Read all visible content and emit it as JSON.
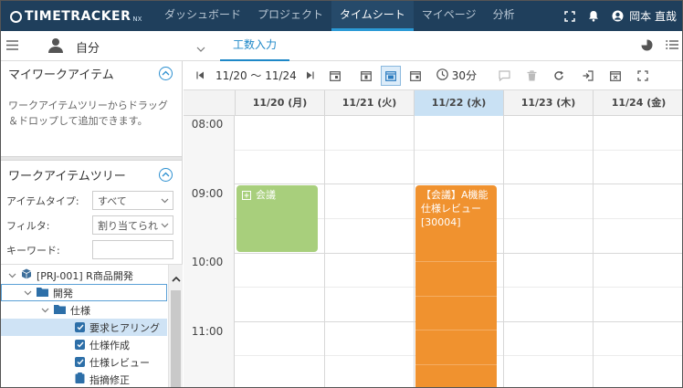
{
  "app": {
    "logo_text": "TIMETRACKER",
    "logo_sub": "NX"
  },
  "nav": {
    "items": [
      {
        "label": "ダッシュボード",
        "active": false
      },
      {
        "label": "プロジェクト",
        "active": false
      },
      {
        "label": "タイムシート",
        "active": true
      },
      {
        "label": "マイページ",
        "active": false
      },
      {
        "label": "分析",
        "active": false
      }
    ],
    "user_name": "岡本 直哉"
  },
  "secondbar": {
    "user_label": "自分",
    "tab_label": "工数入力"
  },
  "left": {
    "mywork": {
      "title": "マイワークアイテム",
      "description": "ワークアイテムツリーからドラッグ＆ドロップして追加できます。"
    },
    "tree_panel": {
      "title": "ワークアイテムツリー",
      "filters": [
        {
          "label": "アイテムタイプ:",
          "value": "すべて"
        },
        {
          "label": "フィルタ:",
          "value": "割り当てられ"
        },
        {
          "label": "キーワード:",
          "value": ""
        }
      ],
      "nodes": [
        {
          "label": "[PRJ-001] R商品開発",
          "level": 0
        },
        {
          "label": "開発",
          "level": 1
        },
        {
          "label": "仕様",
          "level": 2
        },
        {
          "label": "要求ヒアリング",
          "level": 3
        },
        {
          "label": "仕様作成",
          "level": 3
        },
        {
          "label": "仕様レビュー",
          "level": 3
        },
        {
          "label": "指摘修正",
          "level": 3
        }
      ]
    }
  },
  "calendar": {
    "date_range": "11/20 ～ 11/24",
    "interval_label": "30分",
    "days": [
      {
        "label": "11/20 (月)",
        "today": false
      },
      {
        "label": "11/21 (火)",
        "today": false
      },
      {
        "label": "11/22 (水)",
        "today": true
      },
      {
        "label": "11/23 (木)",
        "today": false
      },
      {
        "label": "11/24 (金)",
        "today": false
      }
    ],
    "hours": [
      "08:00",
      "09:00",
      "10:00",
      "11:00"
    ],
    "events": [
      {
        "day": 0,
        "title": "会議",
        "color": "#a8cf7c"
      },
      {
        "day": 2,
        "title": "【会議】A機能仕様レビュー[30004]",
        "color": "#f0922f"
      }
    ]
  },
  "colors": {
    "nav_bg": "#1f3f5c",
    "accent": "#1e88c8",
    "today_header": "#c9e1f4"
  }
}
